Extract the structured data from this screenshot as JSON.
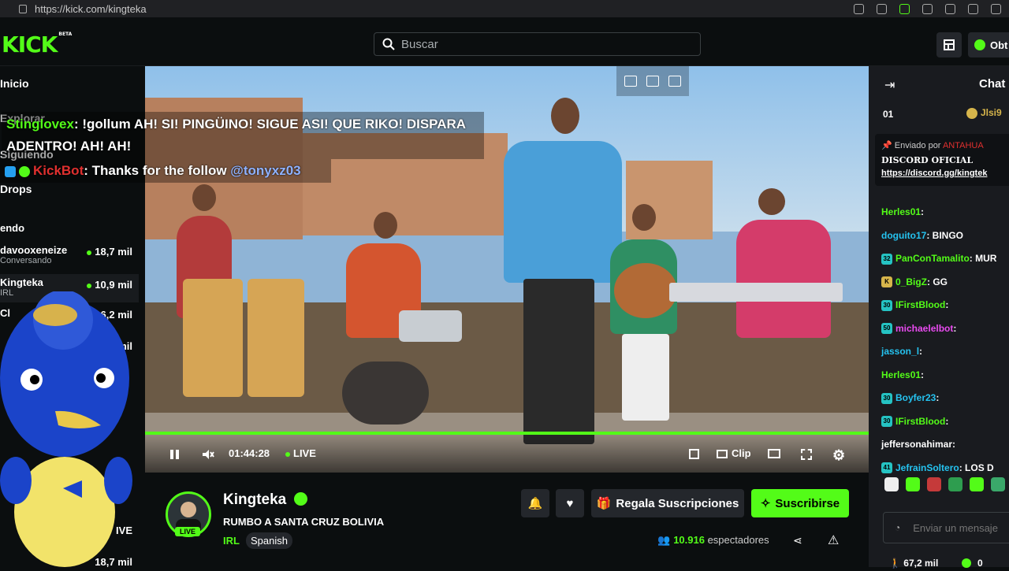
{
  "browser": {
    "url": "https://kick.com/kingteka"
  },
  "header": {
    "logo": "KICK",
    "logo_beta": "BETA",
    "search_placeholder": "Buscar",
    "get_button": "Obt"
  },
  "sidebar": {
    "home": "Inicio",
    "following_partial": "Explorar",
    "following": "Siguiendo",
    "drops": "Drops",
    "recommended": "endo",
    "channels": [
      {
        "name": "davooxeneize",
        "sub": "Conversando",
        "viewers": "18,7 mil"
      },
      {
        "name": "Kingteka",
        "sub": "IRL",
        "viewers": "10,9 mil"
      },
      {
        "name": "Cl",
        "sub": "",
        "viewers": "6,2 mil"
      },
      {
        "name": "",
        "sub": "",
        "viewers": "mil"
      },
      {
        "name": "",
        "sub": "",
        "viewers": "IVE"
      },
      {
        "name": "",
        "sub": "",
        "viewers": "18,7 mil"
      }
    ]
  },
  "overlay_chat": [
    {
      "user": "Stinglovex",
      "text": ": !gollum AH! SI! PINGÜINO! SIGUE ASI! QUE RIKO! DISPARA ADENTRO! AH! AH!"
    },
    {
      "user": "KickBot",
      "text": ": Thanks for the follow ",
      "mention": "@tonyxz03"
    }
  ],
  "player": {
    "time": "01:44:28",
    "live": "LIVE",
    "clip": "Clip",
    "progress": 1.0
  },
  "stream": {
    "channel": "Kingteka",
    "title": "RUMBO A SANTA CRUZ BOLIVIA",
    "category": "IRL",
    "language": "Spanish",
    "live_badge": "LIVE",
    "gift_button": "Regala Suscripciones",
    "subscribe_button": "Suscribirse",
    "viewers_count": "10.916",
    "viewers_label": "espectadores"
  },
  "chat": {
    "title": "Chat",
    "top_left": "01",
    "top_right": "Jlsi9",
    "pinned_by_label": "Enviado por",
    "pinned_by_user": "ANTAHUA",
    "pinned_title": "DISCORD OFICIAL",
    "pinned_link": "https://discord.gg/kingtek",
    "messages": [
      {
        "badge": "",
        "user": "Herles01",
        "text": ":",
        "color": "#53fc18"
      },
      {
        "badge": "",
        "user": "doguito17",
        "text": ": BINGO",
        "color": "#25c3f0"
      },
      {
        "badge": "32",
        "user": "PanConTamalito",
        "text": ": MUR",
        "color": "#53fc18"
      },
      {
        "badge": "K",
        "user": "0_BigZ",
        "text": ": GG",
        "color": "#53fc18"
      },
      {
        "badge": "30",
        "user": "IFirstBlood",
        "text": ":",
        "color": "#53fc18"
      },
      {
        "badge": "50",
        "user": "michaelelbot",
        "text": ":",
        "color": "#e94bf0"
      },
      {
        "badge": "",
        "user": "jasson_l",
        "text": ":",
        "color": "#25c3f0"
      },
      {
        "badge": "",
        "user": "Herles01",
        "text": ":",
        "color": "#53fc18"
      },
      {
        "badge": "30",
        "user": "Boyfer23",
        "text": ":",
        "color": "#25c3f0"
      },
      {
        "badge": "30",
        "user": "IFirstBlood",
        "text": ":",
        "color": "#53fc18"
      },
      {
        "badge": "",
        "user": "jeffersonahimar",
        "text": ":",
        "color": "#fff"
      },
      {
        "badge": "41",
        "user": "JefrainSoltero",
        "text": ": LOS D",
        "color": "#25c3f0"
      }
    ],
    "input_placeholder": "Enviar un mensaje",
    "footer_left": "67,2 mil",
    "footer_right": "0"
  },
  "colors": {
    "accent": "#53fc18",
    "bg": "#0b0e0f",
    "chat_bg": "#191b1f"
  }
}
